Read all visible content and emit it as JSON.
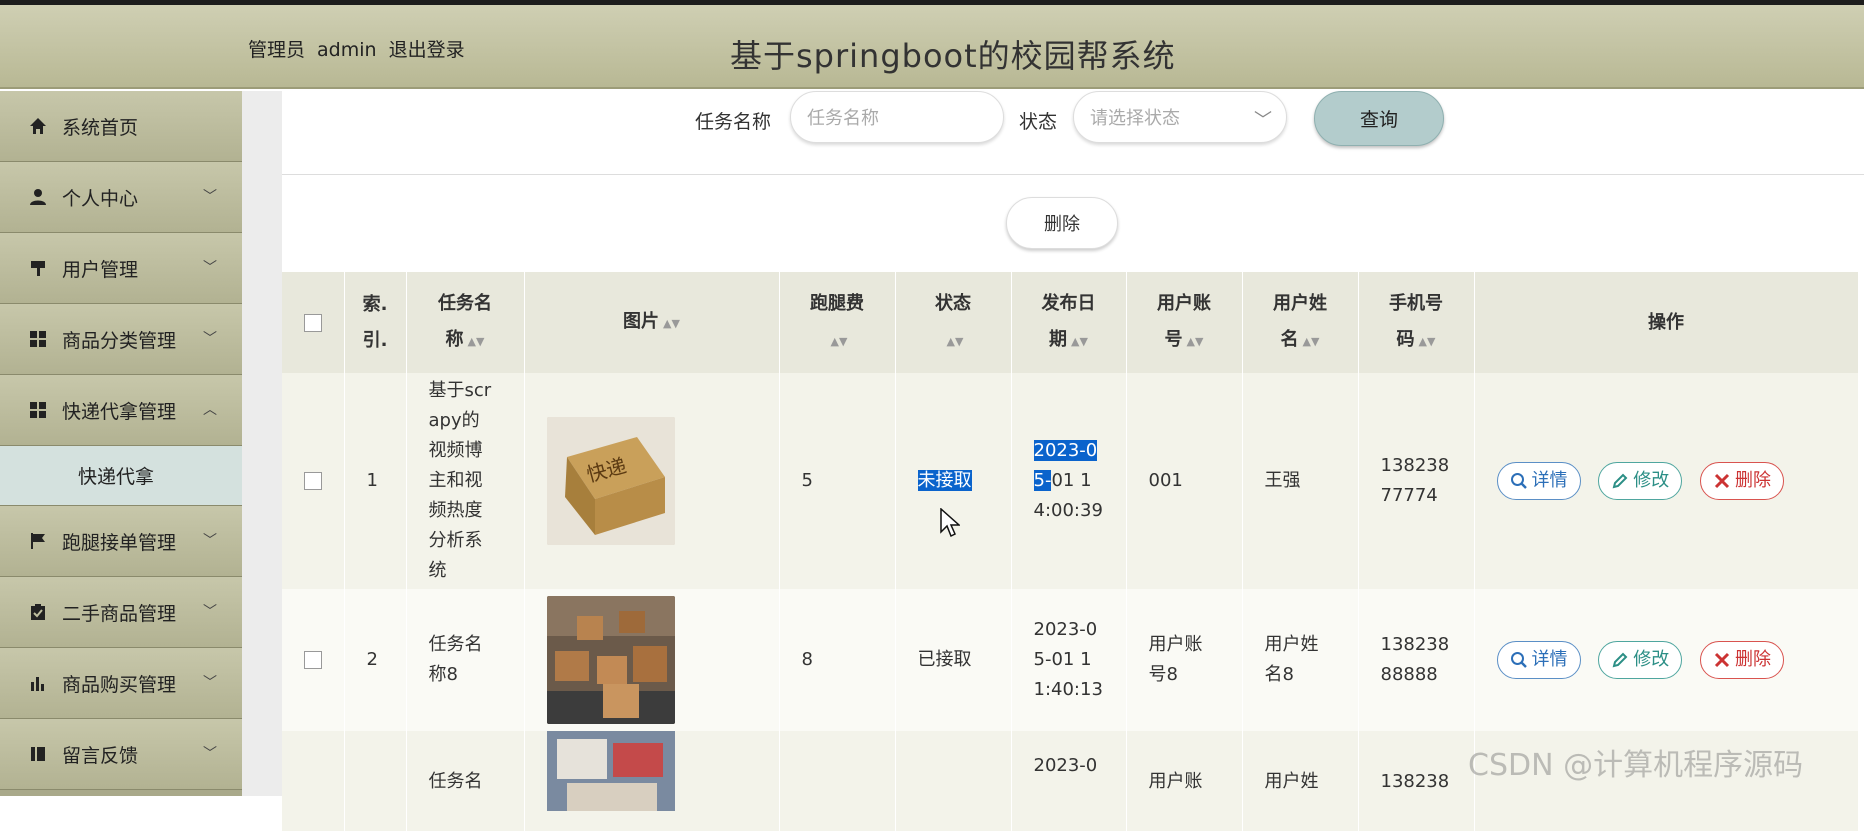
{
  "header": {
    "role": "管理员",
    "username": "admin",
    "logout": "退出登录",
    "title": "基于springboot的校园帮系统"
  },
  "sidebar": {
    "items": [
      {
        "label": "系统首页",
        "icon": "home-icon"
      },
      {
        "label": "个人中心",
        "icon": "user-icon"
      },
      {
        "label": "用户管理",
        "icon": "sign-icon"
      },
      {
        "label": "商品分类管理",
        "icon": "grid-icon"
      },
      {
        "label": "快递代拿管理",
        "icon": "grid-icon"
      },
      {
        "label": "快递代拿",
        "icon": ""
      },
      {
        "label": "跑腿接单管理",
        "icon": "flag-icon"
      },
      {
        "label": "二手商品管理",
        "icon": "clipboard-icon"
      },
      {
        "label": "商品购买管理",
        "icon": "bar-chart-icon"
      },
      {
        "label": "留言反馈",
        "icon": "book-icon"
      }
    ]
  },
  "search": {
    "task_label": "任务名称",
    "task_placeholder": "任务名称",
    "status_label": "状态",
    "status_placeholder": "请选择状态",
    "query_button": "查询"
  },
  "toolbar": {
    "delete_button": "删除"
  },
  "table": {
    "headers": {
      "index": [
        "索.",
        "引."
      ],
      "task_name": [
        "任务名",
        "称"
      ],
      "image": "图片",
      "fee": "跑腿费",
      "status": "状态",
      "date": [
        "发布日",
        "期"
      ],
      "account": [
        "用户账",
        "号"
      ],
      "name": [
        "用户姓",
        "名"
      ],
      "phone": [
        "手机号",
        "码"
      ],
      "ops": "操作"
    },
    "ops": {
      "detail": "详情",
      "edit": "修改",
      "delete": "删除"
    },
    "rows": [
      {
        "index": "1",
        "task_name": [
          "基于scr",
          "apy的",
          "视频博",
          "主和视",
          "频热度",
          "分析系",
          "统"
        ],
        "fee": "5",
        "status": "未接取",
        "date": [
          "2023-0",
          "5-",
          "01 1",
          "4:00:39"
        ],
        "account": "001",
        "name": "王强",
        "phone": [
          "138238",
          "77774"
        ]
      },
      {
        "index": "2",
        "task_name": [
          "任务名",
          "称8"
        ],
        "fee": "8",
        "status": "已接取",
        "date": [
          "2023-0",
          "5-01 1",
          "1:40:13"
        ],
        "account": [
          "用户账",
          "号8"
        ],
        "name": [
          "用户姓",
          "名8"
        ],
        "phone": [
          "138238",
          "88888"
        ]
      },
      {
        "task_name": [
          "任务名"
        ],
        "date": [
          "2023-0"
        ],
        "account": [
          "用户账"
        ],
        "name": [
          "用户姓"
        ],
        "phone": [
          "138238"
        ]
      }
    ]
  },
  "watermark": "CSDN @计算机程序源码"
}
